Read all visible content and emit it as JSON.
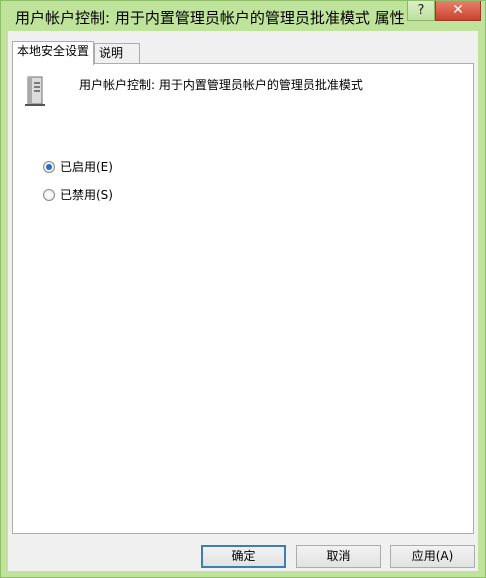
{
  "window": {
    "title": "用户帐户控制: 用于内置管理员帐户的管理员批准模式 属性",
    "help_glyph": "?",
    "close_glyph": "✕"
  },
  "tabs": [
    {
      "label": "本地安全设置",
      "active": true
    },
    {
      "label": "说明",
      "active": false
    }
  ],
  "policy": {
    "icon": "server-icon",
    "title": "用户帐户控制: 用于内置管理员帐户的管理员批准模式"
  },
  "options": [
    {
      "label": "已启用(E)",
      "checked": true
    },
    {
      "label": "已禁用(S)",
      "checked": false
    }
  ],
  "buttons": {
    "ok": "确定",
    "cancel": "取消",
    "apply": "应用(A)"
  }
}
